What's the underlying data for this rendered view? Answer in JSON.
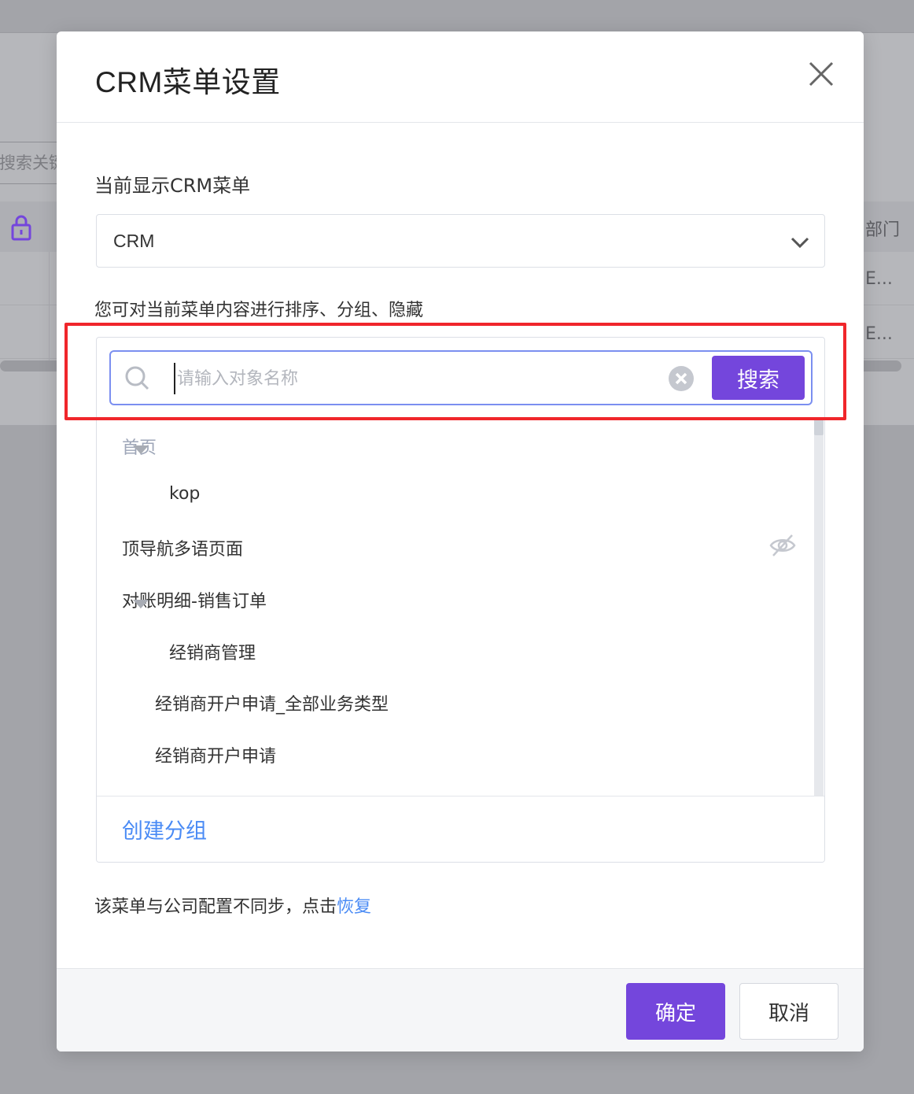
{
  "background": {
    "search_placeholder": "搜索关键",
    "right_col_header": "部门",
    "right_cell_1": "E...",
    "right_cell_2": "E..."
  },
  "modal": {
    "title": "CRM菜单设置",
    "current_menu_label": "当前显示CRM菜单",
    "select_value": "CRM",
    "tip": "您可对当前菜单内容进行排序、分组、隐藏",
    "search": {
      "placeholder": "请输入对象名称",
      "button_label": "搜索"
    },
    "menu_items": [
      {
        "label": "首页",
        "muted": true
      },
      {
        "label": "kop",
        "expandable": true
      },
      {
        "label": "顶导航多语页面",
        "hidden": true
      },
      {
        "label": "对账明细-销售订单"
      },
      {
        "label": "经销商管理",
        "expandable": true
      },
      {
        "label": "经销商开户申请_全部业务类型"
      },
      {
        "label": "经销商开户申请"
      }
    ],
    "create_group_label": "创建分组",
    "sync_note_text": "该菜单与公司配置不同步，点击",
    "sync_link_label": "恢复",
    "ok_label": "确定",
    "cancel_label": "取消"
  },
  "icons": [
    "close-icon",
    "chevron-down-icon",
    "search-icon",
    "clear-icon",
    "caret-down-icon",
    "eye-off-icon",
    "lock-icon"
  ],
  "colors": {
    "primary": "#7446dc",
    "link": "#4a8bf5",
    "highlight": "#f0262b",
    "muted_text": "#9ea6b8"
  }
}
